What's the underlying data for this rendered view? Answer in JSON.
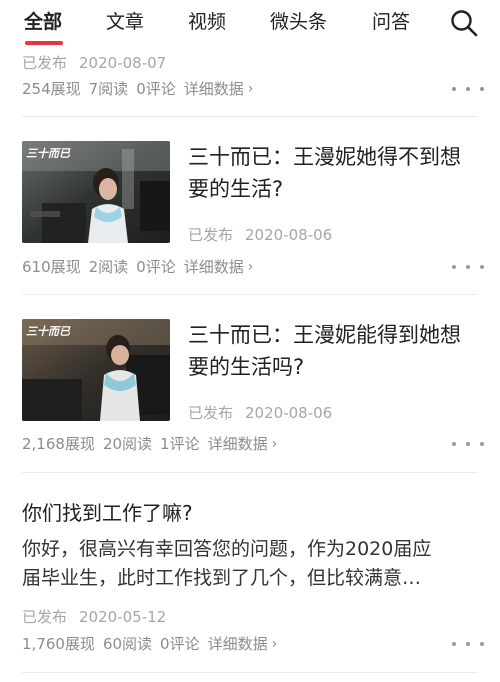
{
  "tabs": [
    {
      "label": "全部",
      "active": true
    },
    {
      "label": "文章",
      "active": false
    },
    {
      "label": "视频",
      "active": false
    },
    {
      "label": "微头条",
      "active": false
    },
    {
      "label": "问答",
      "active": false
    }
  ],
  "accent_color": "#e8343e",
  "search_icon": "search-icon",
  "items": [
    {
      "status": "已发布",
      "date": "2020-08-07",
      "stats": {
        "impressions": "254展现",
        "reads": "7阅读",
        "comments": "0评论",
        "detail_label": "详细数据"
      }
    },
    {
      "title": "三十而已：王漫妮她得不到想要的生活?",
      "thumbnail_caption": "三十而已",
      "status": "已发布",
      "date": "2020-08-06",
      "stats": {
        "impressions": "610展现",
        "reads": "2阅读",
        "comments": "0评论",
        "detail_label": "详细数据"
      }
    },
    {
      "title": "三十而已：王漫妮能得到她想要的生活吗?",
      "thumbnail_caption": "三十而已",
      "status": "已发布",
      "date": "2020-08-06",
      "stats": {
        "impressions": "2,168展现",
        "reads": "20阅读",
        "comments": "1评论",
        "detail_label": "详细数据"
      }
    },
    {
      "title": "你们找到工作了嘛?",
      "body_lines": [
        "你好，很高兴有幸回答您的问题，作为2020届应",
        "届毕业生，此时工作找到了几个，但比较满意…"
      ],
      "status": "已发布",
      "date": "2020-05-12",
      "stats": {
        "impressions": "1,760展现",
        "reads": "60阅读",
        "comments": "0评论",
        "detail_label": "详细数据"
      }
    }
  ],
  "chevron": "›"
}
